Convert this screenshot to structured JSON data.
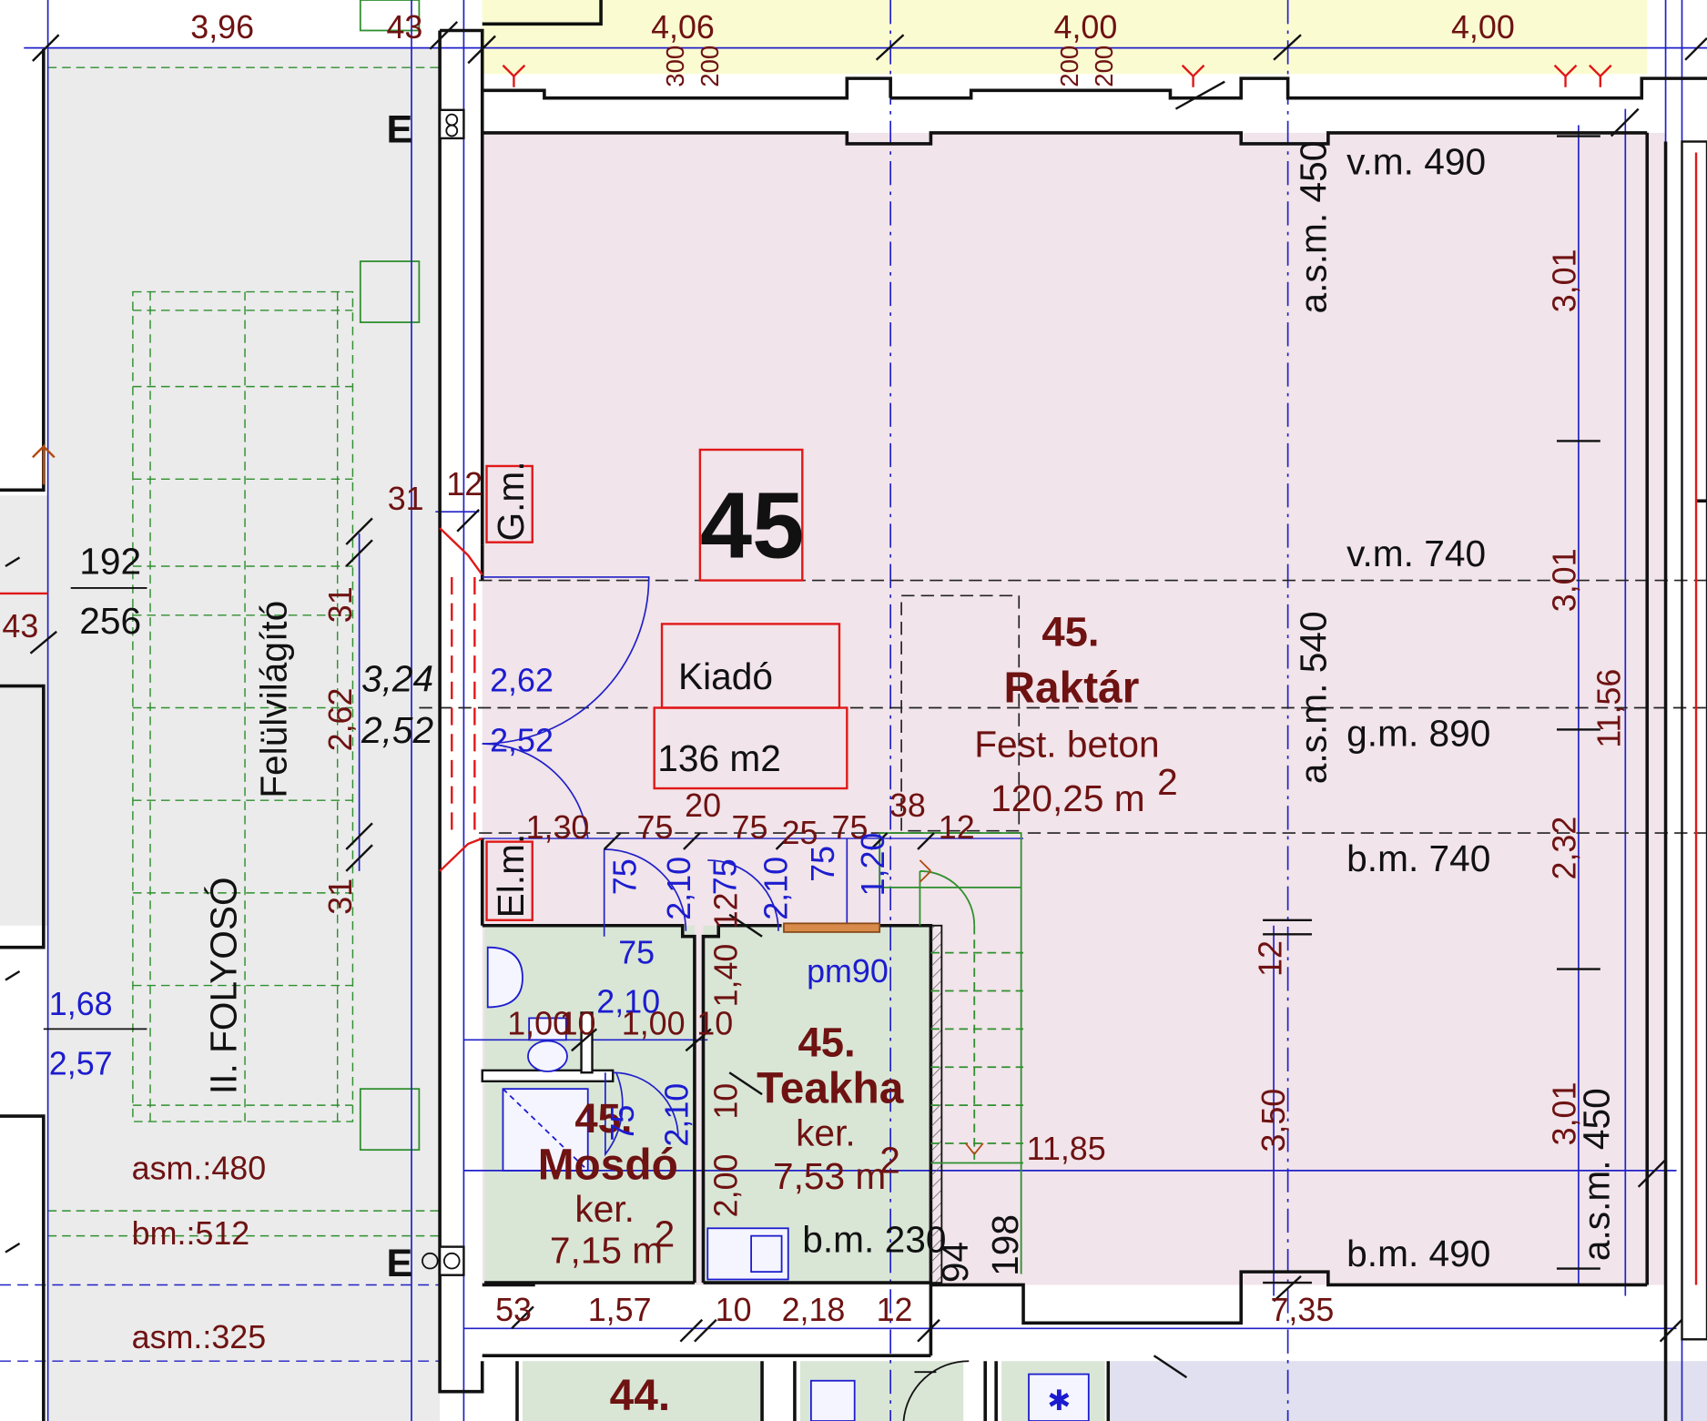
{
  "top_dims": [
    "3,96",
    "43",
    "4,06",
    "4,00",
    "4,00"
  ],
  "top_small": [
    "300",
    "200",
    "200",
    "200"
  ],
  "unit_number": "45",
  "label_box": {
    "title": "Kiadó",
    "area": "136 m2"
  },
  "rooms": {
    "storage": {
      "num": "45.",
      "name": "Raktár",
      "floor": "Fest. beton",
      "area": "120,25 m",
      "sup": "2"
    },
    "tea": {
      "num": "45.",
      "name": "Teakha",
      "floor": "ker.",
      "area": "7,53 m",
      "sup": "2"
    },
    "wash": {
      "num": "45.",
      "name": "Mosdó",
      "floor": "ker.",
      "area": "7,15 m",
      "sup": "2"
    },
    "next_unit": "44."
  },
  "markers": {
    "gm": "G.m.",
    "elm": "El.m.",
    "pm90": "pm90",
    "e1": "E",
    "e2": "E"
  },
  "corridor": {
    "name": "II. FOLYOSÓ",
    "skylight": "Felülvilágító",
    "asm480": "asm.:480",
    "bm512": "bm.:512",
    "asm325": "asm.:325"
  },
  "door_left": {
    "num_top": "192",
    "num_bot": "256",
    "w_top": "1,68",
    "w_bot": "2,57",
    "dim_43": "43"
  },
  "opening": {
    "d31a": "31",
    "d262": "2,62",
    "d31b": "31",
    "h324": "3,24",
    "h252": "2,52",
    "w262": "2,62",
    "w252": "2,52",
    "d31top": "31",
    "d12top": "12"
  },
  "heights": {
    "vm490": "v.m. 490",
    "vm740": "v.m. 740",
    "gm890": "g.m. 890",
    "bm740": "b.m. 740",
    "bm490": "b.m. 490",
    "asm450a": "a.s.m. 450",
    "asm540": "a.s.m. 540",
    "asm450b": "a.s.m. 450",
    "bm230": "b.m. 230"
  },
  "right_dims": {
    "d301a": "3,01",
    "d301b": "3,01",
    "d232": "2,32",
    "d301c": "3,01",
    "total": "11,56",
    "d12": "12",
    "d350": "3,50"
  },
  "inner_dims": {
    "row1": [
      "1,30",
      "75",
      "20",
      "75",
      "25",
      "75",
      "38",
      "12"
    ],
    "door_w": [
      "75",
      "2,10",
      "75",
      "2,10",
      "75",
      "1,20"
    ],
    "wash": [
      "75",
      "2,10",
      "1,00",
      "10",
      "1,00",
      "10",
      "2,10",
      "75"
    ],
    "tea": [
      "12",
      "1,40",
      "10",
      "2,00"
    ],
    "d1185": "11,85",
    "d94": "94",
    "d198": "198"
  },
  "bottom_dims": [
    "53",
    "1,57",
    "10",
    "2,18",
    "12",
    "7,35"
  ]
}
